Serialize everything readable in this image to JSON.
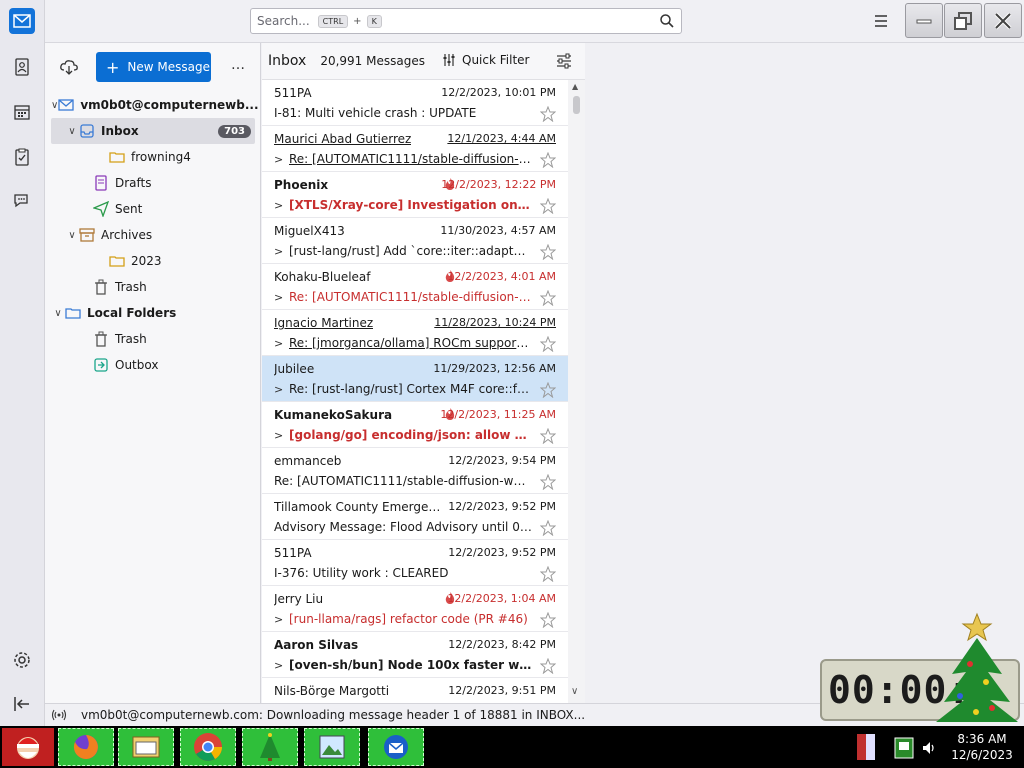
{
  "search": {
    "placeholder": "Search...",
    "key1": "CTRL",
    "plus": "+",
    "key2": "K"
  },
  "folder_pane": {
    "new_message": "New Message",
    "more": "…",
    "folders": [
      {
        "label": "vm0b0t@computernewb...",
        "icon": "account-icon",
        "chevron": "∨",
        "bold": true
      },
      {
        "label": "Inbox",
        "icon": "inbox-icon",
        "chevron": "∨",
        "bold": true,
        "badge": "703",
        "selected": true
      },
      {
        "label": "frowning4",
        "icon": "folder-icon"
      },
      {
        "label": "Drafts",
        "icon": "drafts-icon"
      },
      {
        "label": "Sent",
        "icon": "sent-icon"
      },
      {
        "label": "Archives",
        "icon": "archive-icon",
        "chevron": "∨"
      },
      {
        "label": "2023",
        "icon": "folder-icon"
      },
      {
        "label": "Trash",
        "icon": "trash-icon"
      },
      {
        "label": "Local Folders",
        "icon": "local-folders-icon",
        "chevron": "∨",
        "bold": true
      },
      {
        "label": "Trash",
        "icon": "trash-icon"
      },
      {
        "label": "Outbox",
        "icon": "outbox-icon"
      }
    ]
  },
  "message_list": {
    "title": "Inbox",
    "count": "20,991 Messages",
    "quick_filter": "Quick Filter",
    "messages": [
      {
        "from": "511PA",
        "date": "12/2/2023, 10:01 PM",
        "subject": "I-81: Multi vehicle crash : UPDATE",
        "thread": false,
        "unread": false,
        "red": false,
        "underline": false,
        "hot": false,
        "selected": false
      },
      {
        "from": "Maurici Abad Gutierrez",
        "date": "12/1/2023, 4:44 AM",
        "subject": "Re: [AUTOMATIC1111/stable-diffusion-w...",
        "thread": true,
        "unread": false,
        "red": false,
        "underline": true,
        "hot": false,
        "selected": false
      },
      {
        "from": "Phoenix",
        "date": "12/2/2023, 12:22 PM",
        "subject": "[XTLS/Xray-core] Investigation on Blocki...",
        "thread": true,
        "unread": true,
        "red": true,
        "underline": false,
        "hot": true,
        "selected": false
      },
      {
        "from": "MiguelX413",
        "date": "11/30/2023, 4:57 AM",
        "subject": "[rust-lang/rust] Add `core::iter::adapters:...",
        "thread": true,
        "unread": false,
        "red": false,
        "underline": false,
        "hot": false,
        "selected": false
      },
      {
        "from": "Kohaku-Blueleaf",
        "date": "12/2/2023, 4:01 AM",
        "subject": "Re: [AUTOMATIC1111/stable-diffusion-web...",
        "thread": true,
        "unread": false,
        "red": true,
        "underline": false,
        "hot": true,
        "selected": false
      },
      {
        "from": "Ignacio Martinez",
        "date": "11/28/2023, 10:24 PM",
        "subject": "Re: [jmorganca/ollama] ROCm support ...",
        "thread": true,
        "unread": false,
        "red": false,
        "underline": true,
        "hot": false,
        "selected": false
      },
      {
        "from": "Jubilee",
        "date": "11/29/2023, 12:56 AM",
        "subject": "Re: [rust-lang/rust] Cortex M4F core::fmt...",
        "thread": true,
        "unread": false,
        "red": false,
        "underline": false,
        "hot": false,
        "selected": true
      },
      {
        "from": "KumanekoSakura",
        "date": "12/2/2023, 11:25 AM",
        "subject": "[golang/go] encoding/json: allow struct ...",
        "thread": true,
        "unread": true,
        "red": true,
        "underline": false,
        "hot": true,
        "selected": false
      },
      {
        "from": "emmanceb",
        "date": "12/2/2023, 9:54 PM",
        "subject": "Re: [AUTOMATIC1111/stable-diffusion-web...",
        "thread": false,
        "unread": false,
        "red": false,
        "underline": false,
        "hot": false,
        "selected": false
      },
      {
        "from": "Tillamook County Emergency ...",
        "date": "12/2/2023, 9:52 PM",
        "subject": "Advisory Message: Flood Advisory until 01...",
        "thread": false,
        "unread": false,
        "red": false,
        "underline": false,
        "hot": false,
        "selected": false
      },
      {
        "from": "511PA",
        "date": "12/2/2023, 9:52 PM",
        "subject": "I-376: Utility work : CLEARED",
        "thread": false,
        "unread": false,
        "red": false,
        "underline": false,
        "hot": false,
        "selected": false
      },
      {
        "from": "Jerry Liu",
        "date": "12/2/2023, 1:04 AM",
        "subject": "[run-llama/rags] refactor code (PR #46)",
        "thread": true,
        "unread": false,
        "red": true,
        "underline": false,
        "hot": true,
        "selected": false
      },
      {
        "from": "Aaron Silvas",
        "date": "12/2/2023, 8:42 PM",
        "subject": "[oven-sh/bun] Node 100x faster writi...",
        "thread": true,
        "unread": true,
        "red": false,
        "underline": false,
        "hot": false,
        "selected": false
      },
      {
        "from": "Nils-Börge Margotti",
        "date": "12/2/2023, 9:51 PM",
        "subject": "",
        "thread": false,
        "unread": false,
        "red": false,
        "underline": false,
        "hot": false,
        "selected": false
      }
    ]
  },
  "status_bar": {
    "text": "vm0b0t@computernewb.com: Downloading message header 1 of 18881 in INBOX..."
  },
  "clock_widget": {
    "display": "00:00:"
  },
  "taskbar": {
    "time": "8:36 AM",
    "date": "12/6/2023"
  }
}
